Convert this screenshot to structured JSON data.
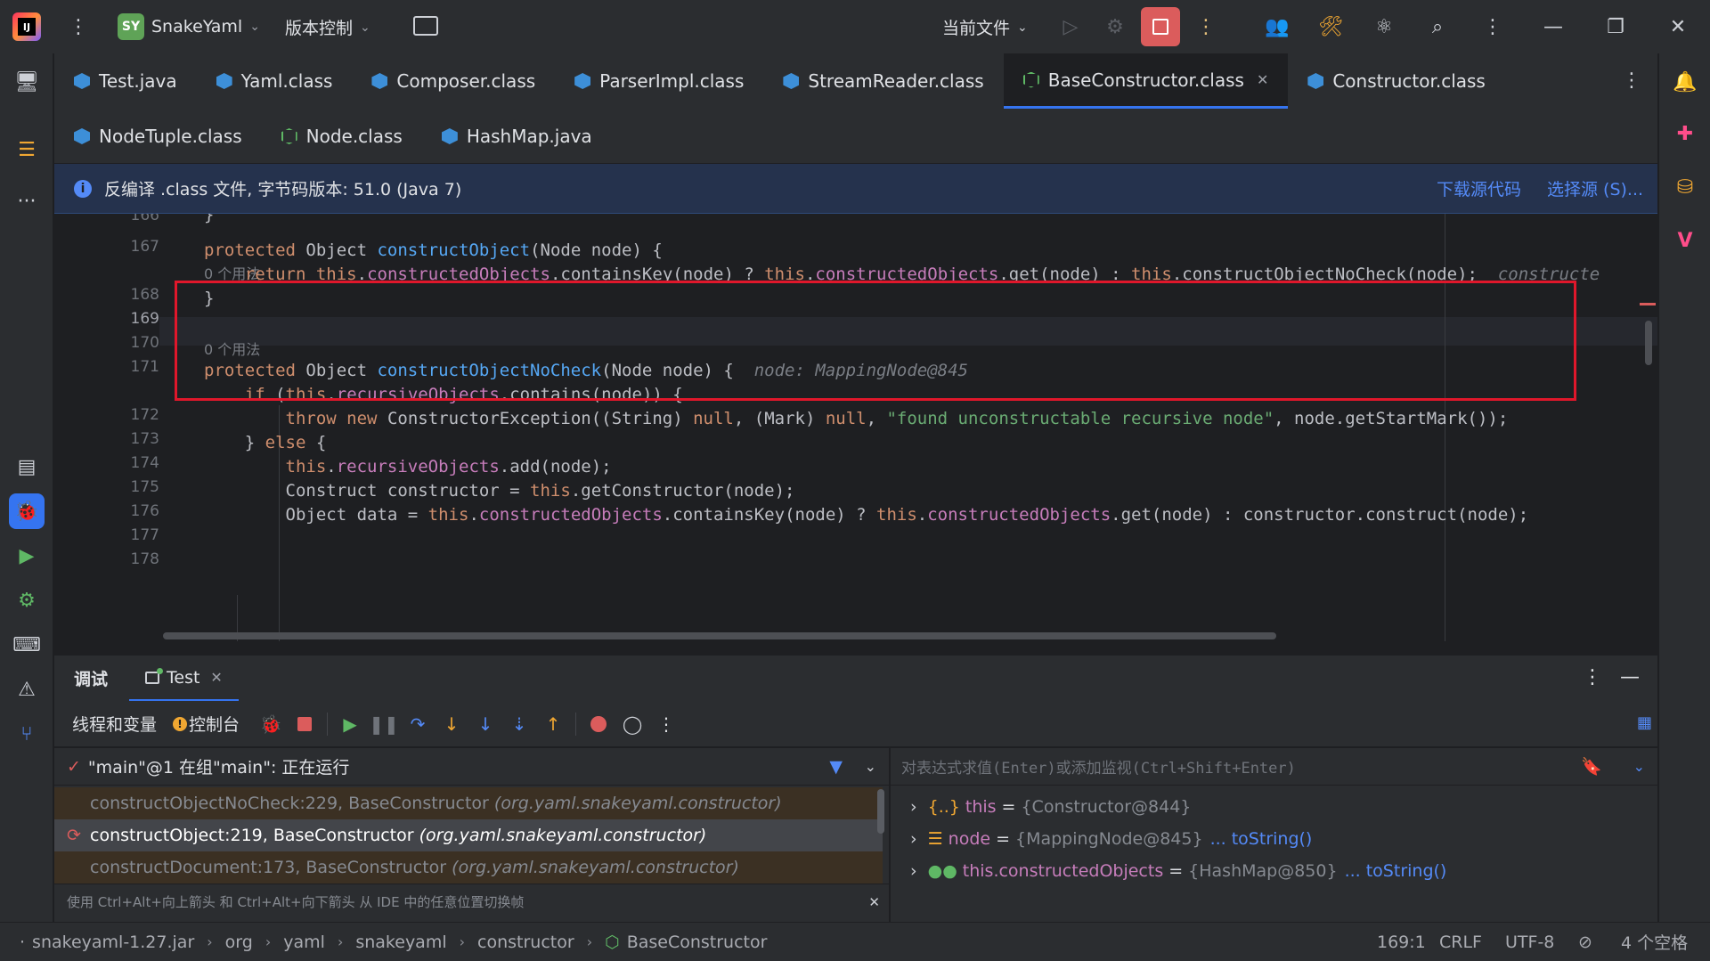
{
  "titlebar": {
    "project_badge": "SY",
    "project_name": "SnakeYaml",
    "vcs_menu": "版本控制",
    "run_config": "当前文件"
  },
  "tabs_row1": [
    {
      "label": "Test.java",
      "active": false
    },
    {
      "label": "Yaml.class",
      "active": false
    },
    {
      "label": "Composer.class",
      "active": false
    },
    {
      "label": "ParserImpl.class",
      "active": false
    },
    {
      "label": "StreamReader.class",
      "active": false
    },
    {
      "label": "BaseConstructor.class",
      "active": true
    },
    {
      "label": "Constructor.class",
      "active": false
    }
  ],
  "tabs_row2": [
    {
      "label": "NodeTuple.class"
    },
    {
      "label": "Node.class"
    },
    {
      "label": "HashMap.java"
    }
  ],
  "banner": {
    "text": "反编译 .class 文件, 字节码版本: 51.0 (Java 7)",
    "download_link": "下载源代码",
    "choose_link": "选择源 (S)..."
  },
  "editor": {
    "line_numbers": [
      "166",
      "167",
      "168",
      "169",
      "170",
      "171",
      "172",
      "173",
      "174",
      "175",
      "176",
      "177",
      "178"
    ],
    "usage_hint_1": "0 个用法",
    "usage_hint_2": "0 个用法",
    "inlay_hint_172": "node: MappingNode@845",
    "inlay_hint_169": "constructe",
    "current_line": "169"
  },
  "debug": {
    "panel_title": "调试",
    "session_tab": "Test",
    "subtab_threads": "线程和变量",
    "subtab_console": "控制台",
    "thread_label": "\"main\"@1 在组\"main\": 正在运行",
    "eval_placeholder": "对表达式求值(Enter)或添加监视(Ctrl+Shift+Enter)",
    "frames": [
      {
        "method": "constructObjectNoCheck:229, BaseConstructor",
        "pkg": "(org.yaml.snakeyaml.constructor)",
        "current": false
      },
      {
        "method": "constructObject:219, BaseConstructor",
        "pkg": "(org.yaml.snakeyaml.constructor)",
        "current": true
      },
      {
        "method": "constructDocument:173, BaseConstructor",
        "pkg": "(org.yaml.snakeyaml.constructor)",
        "current": false
      }
    ],
    "frames_hint": "使用 Ctrl+Alt+向上箭头 和 Ctrl+Alt+向下箭头 从 IDE 中的任意位置切换帧",
    "variables": [
      {
        "icon": "{..}",
        "name": "this",
        "eq": "=",
        "value": "{Constructor@844}",
        "link": ""
      },
      {
        "icon": "node-icon",
        "name": "node",
        "eq": "=",
        "value": "{MappingNode@845}",
        "link": "... toString()"
      },
      {
        "icon": "glasses-icon",
        "name": "this.constructedObjects",
        "eq": "=",
        "value": "{HashMap@850}",
        "link": "... toString()"
      }
    ]
  },
  "statusbar": {
    "crumbs": [
      "snakeyaml-1.27.jar",
      "org",
      "yaml",
      "snakeyaml",
      "constructor",
      "BaseConstructor"
    ],
    "position": "169:1",
    "line_sep": "CRLF",
    "encoding": "UTF-8",
    "indent": "4 个空格"
  }
}
